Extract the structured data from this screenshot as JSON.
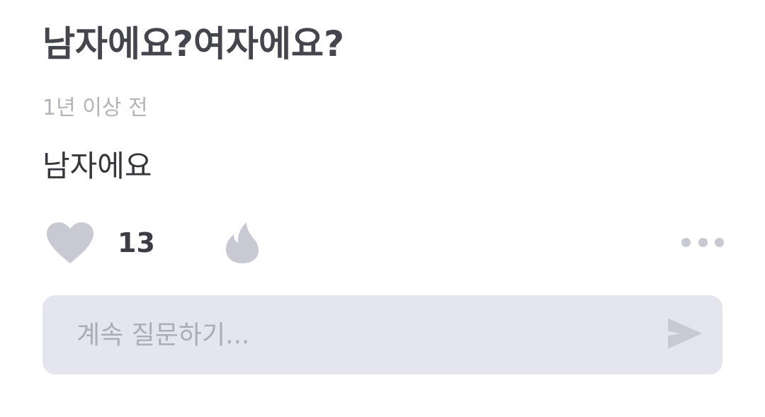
{
  "post": {
    "title": "남자에요?여자에요?",
    "timestamp": "1년 이상 전",
    "body": "남자에요"
  },
  "actions": {
    "like_icon": "heart-icon",
    "like_count": "13",
    "fire_icon": "fire-icon",
    "more_icon": "more-dots-icon"
  },
  "reply": {
    "placeholder": "계속 질문하기...",
    "value": "",
    "send_icon": "send-icon"
  },
  "colors": {
    "title": "#45454d",
    "timestamp": "#b3b3bb",
    "icon": "#c9c9d3",
    "input_background": "#e5e5ef"
  }
}
